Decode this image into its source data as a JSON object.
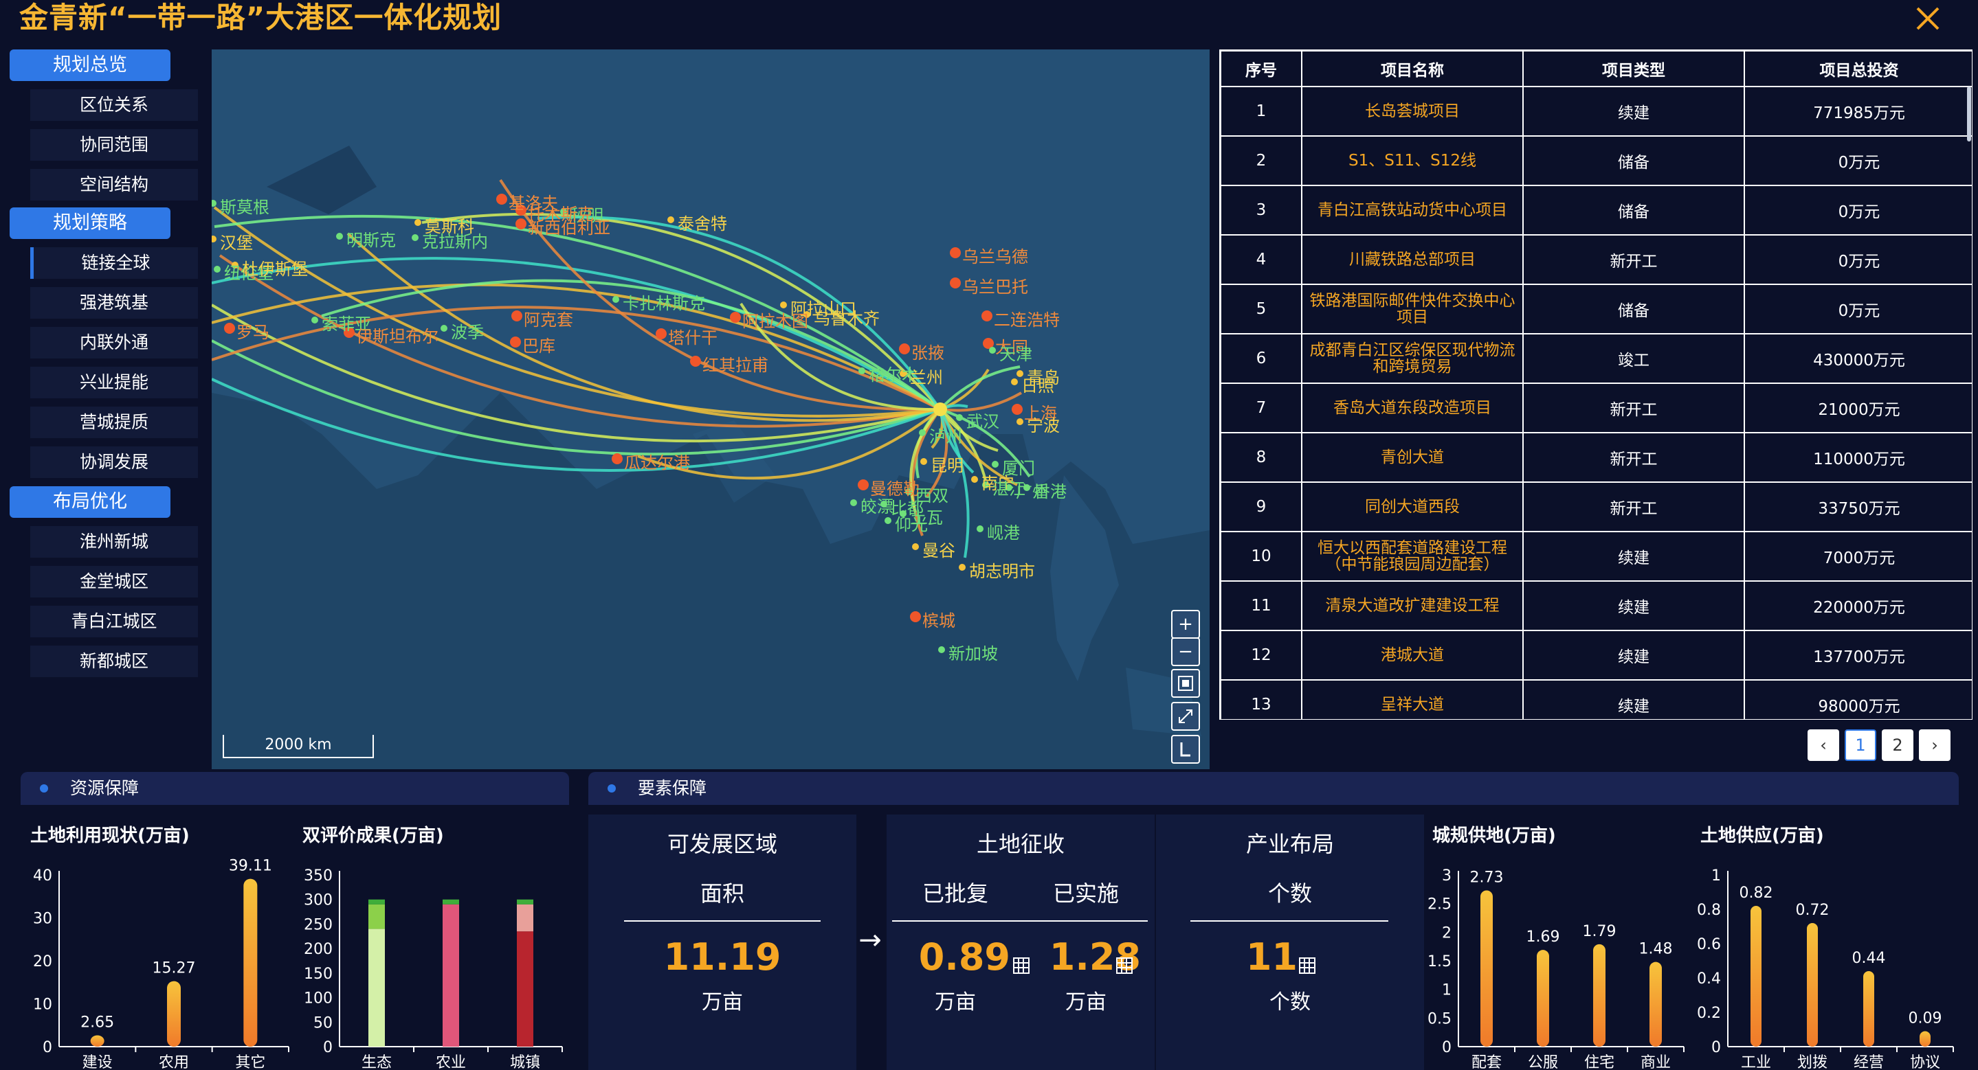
{
  "header": {
    "title": "金青新“一带一路”大港区一体化规划",
    "close_icon": "close-icon"
  },
  "sidebar": {
    "groups": [
      {
        "label": "规划总览",
        "items": [
          "区位关系",
          "协同范围",
          "空间结构"
        ]
      },
      {
        "label": "规划策略",
        "items": [
          "链接全球",
          "强港筑基",
          "内联外通",
          "兴业提能",
          "营城提质",
          "协调发展"
        ]
      },
      {
        "label": "布局优化",
        "items": [
          "淮州新城",
          "金堂城区",
          "青白江城区",
          "新都城区"
        ]
      }
    ],
    "active_item": "链接全球"
  },
  "map": {
    "scale_label": "2000 km",
    "controls": [
      "+",
      "−"
    ],
    "cities": [
      {
        "name": "斯莫根",
        "c": "g"
      },
      {
        "name": "汉堡",
        "c": "y"
      },
      {
        "name": "纽伦堡",
        "c": "g"
      },
      {
        "name": "杜伊斯堡",
        "c": "y"
      },
      {
        "name": "罗马",
        "c": "o"
      },
      {
        "name": "索菲亚",
        "c": "g"
      },
      {
        "name": "伊斯坦布尔",
        "c": "o"
      },
      {
        "name": "明斯克",
        "c": "g"
      },
      {
        "name": "莫斯科",
        "c": "y"
      },
      {
        "name": "克拉斯内",
        "c": "g"
      },
      {
        "name": "基洛夫",
        "c": "o"
      },
      {
        "name": "秋明",
        "c": "g"
      },
      {
        "name": "托木斯克",
        "c": "o"
      },
      {
        "name": "新西伯利亚",
        "c": "o"
      },
      {
        "name": "泰舍特",
        "c": "y"
      },
      {
        "name": "乌兰乌德",
        "c": "o"
      },
      {
        "name": "乌兰巴托",
        "c": "o"
      },
      {
        "name": "二连浩特",
        "c": "o"
      },
      {
        "name": "卡扎林斯克",
        "c": "g"
      },
      {
        "name": "阿拉山口",
        "c": "y"
      },
      {
        "name": "阿拉木图",
        "c": "o"
      },
      {
        "name": "乌鲁木齐",
        "c": "y"
      },
      {
        "name": "阿克套",
        "c": "o"
      },
      {
        "name": "波季",
        "c": "g"
      },
      {
        "name": "巴库",
        "c": "o"
      },
      {
        "name": "塔什干",
        "c": "o"
      },
      {
        "name": "红其拉甫",
        "c": "o"
      },
      {
        "name": "格尔木",
        "c": "g"
      },
      {
        "name": "兰州",
        "c": "y"
      },
      {
        "name": "张掖",
        "c": "o"
      },
      {
        "name": "大同",
        "c": "o"
      },
      {
        "name": "天津",
        "c": "g"
      },
      {
        "name": "青岛",
        "c": "y"
      },
      {
        "name": "日照",
        "c": "y"
      },
      {
        "name": "上海",
        "c": "o"
      },
      {
        "name": "宁波",
        "c": "y"
      },
      {
        "name": "武汉",
        "c": "g"
      },
      {
        "name": "泸州",
        "c": "g"
      },
      {
        "name": "厦门",
        "c": "g"
      },
      {
        "name": "昆明",
        "c": "y"
      },
      {
        "name": "曼德勒",
        "c": "o"
      },
      {
        "name": "皎漂",
        "c": "g"
      },
      {
        "name": "比都",
        "c": "g"
      },
      {
        "name": "仰光",
        "c": "g"
      },
      {
        "name": "土瓦",
        "c": "g"
      },
      {
        "name": "西双",
        "c": "g"
      },
      {
        "name": "曼谷",
        "c": "y"
      },
      {
        "name": "岘港",
        "c": "g"
      },
      {
        "name": "胡志明市",
        "c": "y"
      },
      {
        "name": "槟城",
        "c": "o"
      },
      {
        "name": "新加坡",
        "c": "g"
      },
      {
        "name": "瓜达尔港",
        "c": "o"
      },
      {
        "name": "南宁",
        "c": "y"
      },
      {
        "name": "湛江",
        "c": "g"
      },
      {
        "name": "广州",
        "c": "g"
      },
      {
        "name": "香港",
        "c": "g"
      }
    ]
  },
  "table": {
    "headers": [
      "序号",
      "项目名称",
      "项目类型",
      "项目总投资"
    ],
    "rows": [
      [
        "1",
        "长岛荟城项目",
        "续建",
        "771985万元"
      ],
      [
        "2",
        "S1、S11、S12线",
        "储备",
        "0万元"
      ],
      [
        "3",
        "青白江高铁站动货中心项目",
        "储备",
        "0万元"
      ],
      [
        "4",
        "川藏铁路总部项目",
        "新开工",
        "0万元"
      ],
      [
        "5",
        "铁路港国际邮件快件交换中心项目",
        "储备",
        "0万元"
      ],
      [
        "6",
        "成都青白江区综保区现代物流和跨境贸易",
        "竣工",
        "430000万元"
      ],
      [
        "7",
        "香岛大道东段改造项目",
        "新开工",
        "21000万元"
      ],
      [
        "8",
        "青创大道",
        "新开工",
        "110000万元"
      ],
      [
        "9",
        "同创大道西段",
        "新开工",
        "33750万元"
      ],
      [
        "10",
        "恒大以西配套道路建设工程（中节能琅园周边配套）",
        "续建",
        "7000万元"
      ],
      [
        "11",
        "清泉大道改扩建建设工程",
        "续建",
        "220000万元"
      ],
      [
        "12",
        "港城大道",
        "续建",
        "137700万元"
      ],
      [
        "13",
        "呈祥大道",
        "续建",
        "98000万元"
      ]
    ],
    "pagination": {
      "prev": "‹",
      "pages": [
        "1",
        "2"
      ],
      "next": "›",
      "active": "1"
    }
  },
  "bottom": {
    "resource_label": "资源保障",
    "factor_label": "要素保障",
    "develop": {
      "title": "可发展区域",
      "sub": "面积",
      "value": "11.19",
      "unit": "万亩"
    },
    "arrow": "→",
    "land": {
      "title": "土地征收",
      "sub1": "已批复",
      "sub2": "已实施",
      "value1": "0.89",
      "value2": "1.28",
      "unit": "万亩"
    },
    "industry": {
      "title": "产业布局",
      "sub": "个数",
      "value": "11",
      "unit": "个数"
    }
  },
  "chart_data": [
    {
      "type": "bar",
      "title": "土地利用现状(万亩)",
      "categories": [
        "建设",
        "农用",
        "其它"
      ],
      "values": [
        2.65,
        15.27,
        39.11
      ],
      "ylim": [
        0,
        40
      ],
      "yticks": [
        0,
        10,
        20,
        30,
        40
      ],
      "color_top": "#f7c43c",
      "color_bottom": "#f07a2a"
    },
    {
      "type": "bar",
      "title": "双评价成果(万亩)",
      "categories": [
        "生态",
        "农业",
        "城镇"
      ],
      "ylim": [
        0,
        350
      ],
      "yticks": [
        0,
        50,
        100,
        150,
        200,
        250,
        300,
        350
      ],
      "stacks": [
        [
          {
            "v": 240,
            "color": "#d4f0a8"
          },
          {
            "v": 50,
            "color": "#8cd04a"
          },
          {
            "v": 10,
            "color": "#3fae3a"
          }
        ],
        [
          {
            "v": 290,
            "color": "#e0567a"
          },
          {
            "v": 10,
            "color": "#3fae3a"
          }
        ],
        [
          {
            "v": 235,
            "color": "#b8252e"
          },
          {
            "v": 55,
            "color": "#e8a09a"
          },
          {
            "v": 10,
            "color": "#3fae3a"
          }
        ]
      ]
    },
    {
      "type": "bar",
      "title": "城规供地(万亩)",
      "categories": [
        "配套",
        "公服",
        "住宅",
        "商业"
      ],
      "values": [
        2.73,
        1.69,
        1.79,
        1.48
      ],
      "ylim": [
        0,
        3
      ],
      "yticks": [
        "0",
        "0.5",
        "1",
        "1.5",
        "2",
        "2.5",
        "3"
      ],
      "color_top": "#f7c43c",
      "color_bottom": "#f07a2a"
    },
    {
      "type": "bar",
      "title": "土地供应(万亩)",
      "categories": [
        "工业",
        "划拨",
        "经营",
        "协议"
      ],
      "values": [
        0.82,
        0.72,
        0.44,
        0.09
      ],
      "ylim": [
        0,
        1
      ],
      "yticks": [
        "0",
        "0.2",
        "0.4",
        "0.6",
        "0.8",
        "1"
      ],
      "color_top": "#f7c43c",
      "color_bottom": "#f07a2a"
    }
  ]
}
